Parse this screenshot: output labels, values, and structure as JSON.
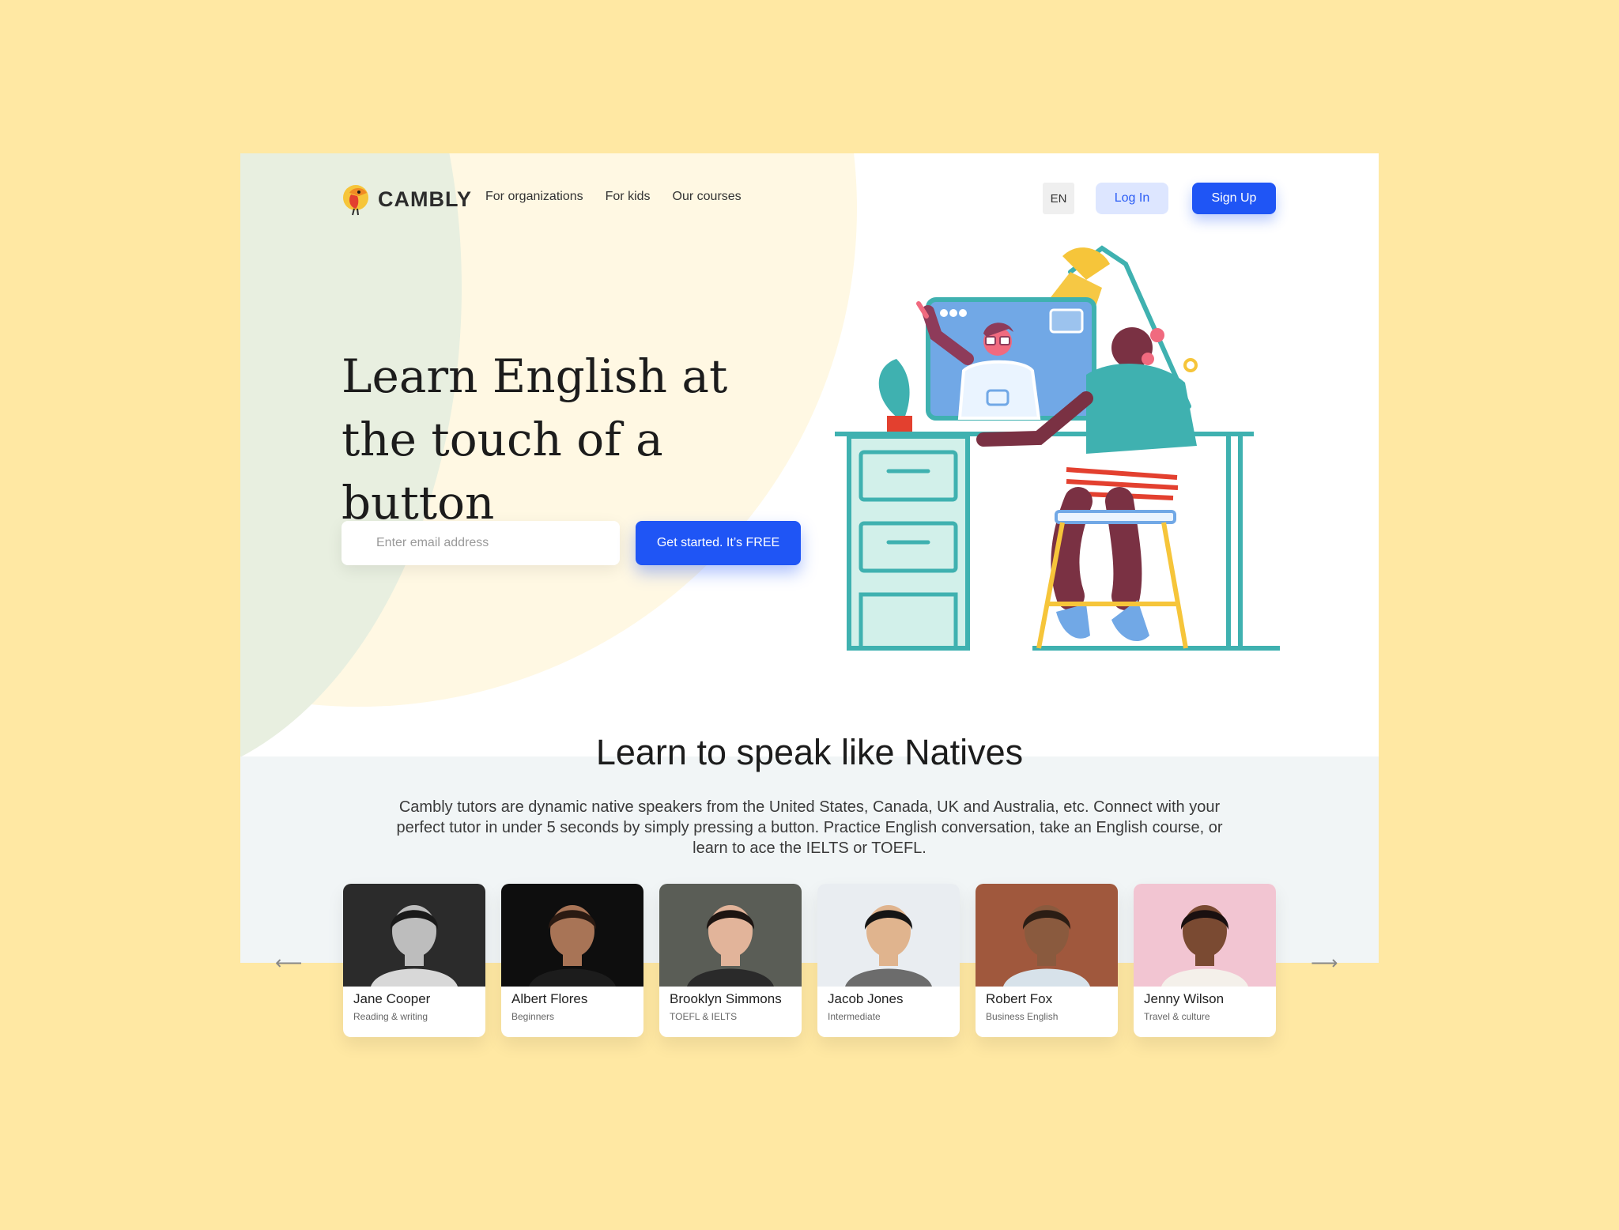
{
  "brand": {
    "name": "CAMBLY"
  },
  "nav": {
    "links": [
      "For organizations",
      "For kids",
      "Our courses"
    ],
    "lang": "EN",
    "login": "Log In",
    "signup": "Sign Up"
  },
  "hero": {
    "title": "Learn English at the touch of a button",
    "email_placeholder": "Enter email address",
    "cta": "Get started. It’s FREE"
  },
  "section": {
    "title": "Learn to speak like Natives",
    "description": "Cambly tutors are dynamic native speakers from the United States, Canada, UK and Australia, etc. Connect with your perfect tutor in under 5 seconds by simply pressing a button. Practice English conversation, take an English course, or learn to ace the IELTS or TOEFL."
  },
  "carousel": {
    "prev_icon": "arrow-left-icon",
    "next_icon": "arrow-right-icon"
  },
  "tutors": [
    {
      "name": "Jane Cooper",
      "subject": "Reading & writing",
      "bg": "#2b2b2b",
      "skin": "#bdbdbd",
      "hair": "#1a1a1a",
      "shirt": "#d8d8d8"
    },
    {
      "name": "Albert Flores",
      "subject": "Beginners",
      "bg": "#0e0e0e",
      "skin": "#a87456",
      "hair": "#2a1a12",
      "shirt": "#1c1c1c"
    },
    {
      "name": "Brooklyn Simmons",
      "subject": "TOEFL & IELTS",
      "bg": "#5a5d56",
      "skin": "#e2b49a",
      "hair": "#1d1512",
      "shirt": "#2a2a2a"
    },
    {
      "name": "Jacob Jones",
      "subject": "Intermediate",
      "bg": "#e9edf1",
      "skin": "#e0b48e",
      "hair": "#151515",
      "shirt": "#6c6c6c"
    },
    {
      "name": "Robert Fox",
      "subject": "Business English",
      "bg": "#a0583d",
      "skin": "#8a5a3e",
      "hair": "#2b1d14",
      "shirt": "#d7e2ea"
    },
    {
      "name": "Jenny Wilson",
      "subject": "Travel & culture",
      "bg": "#f2c5d2",
      "skin": "#7a4a32",
      "hair": "#1a1010",
      "shirt": "#f4f0ea"
    }
  ]
}
